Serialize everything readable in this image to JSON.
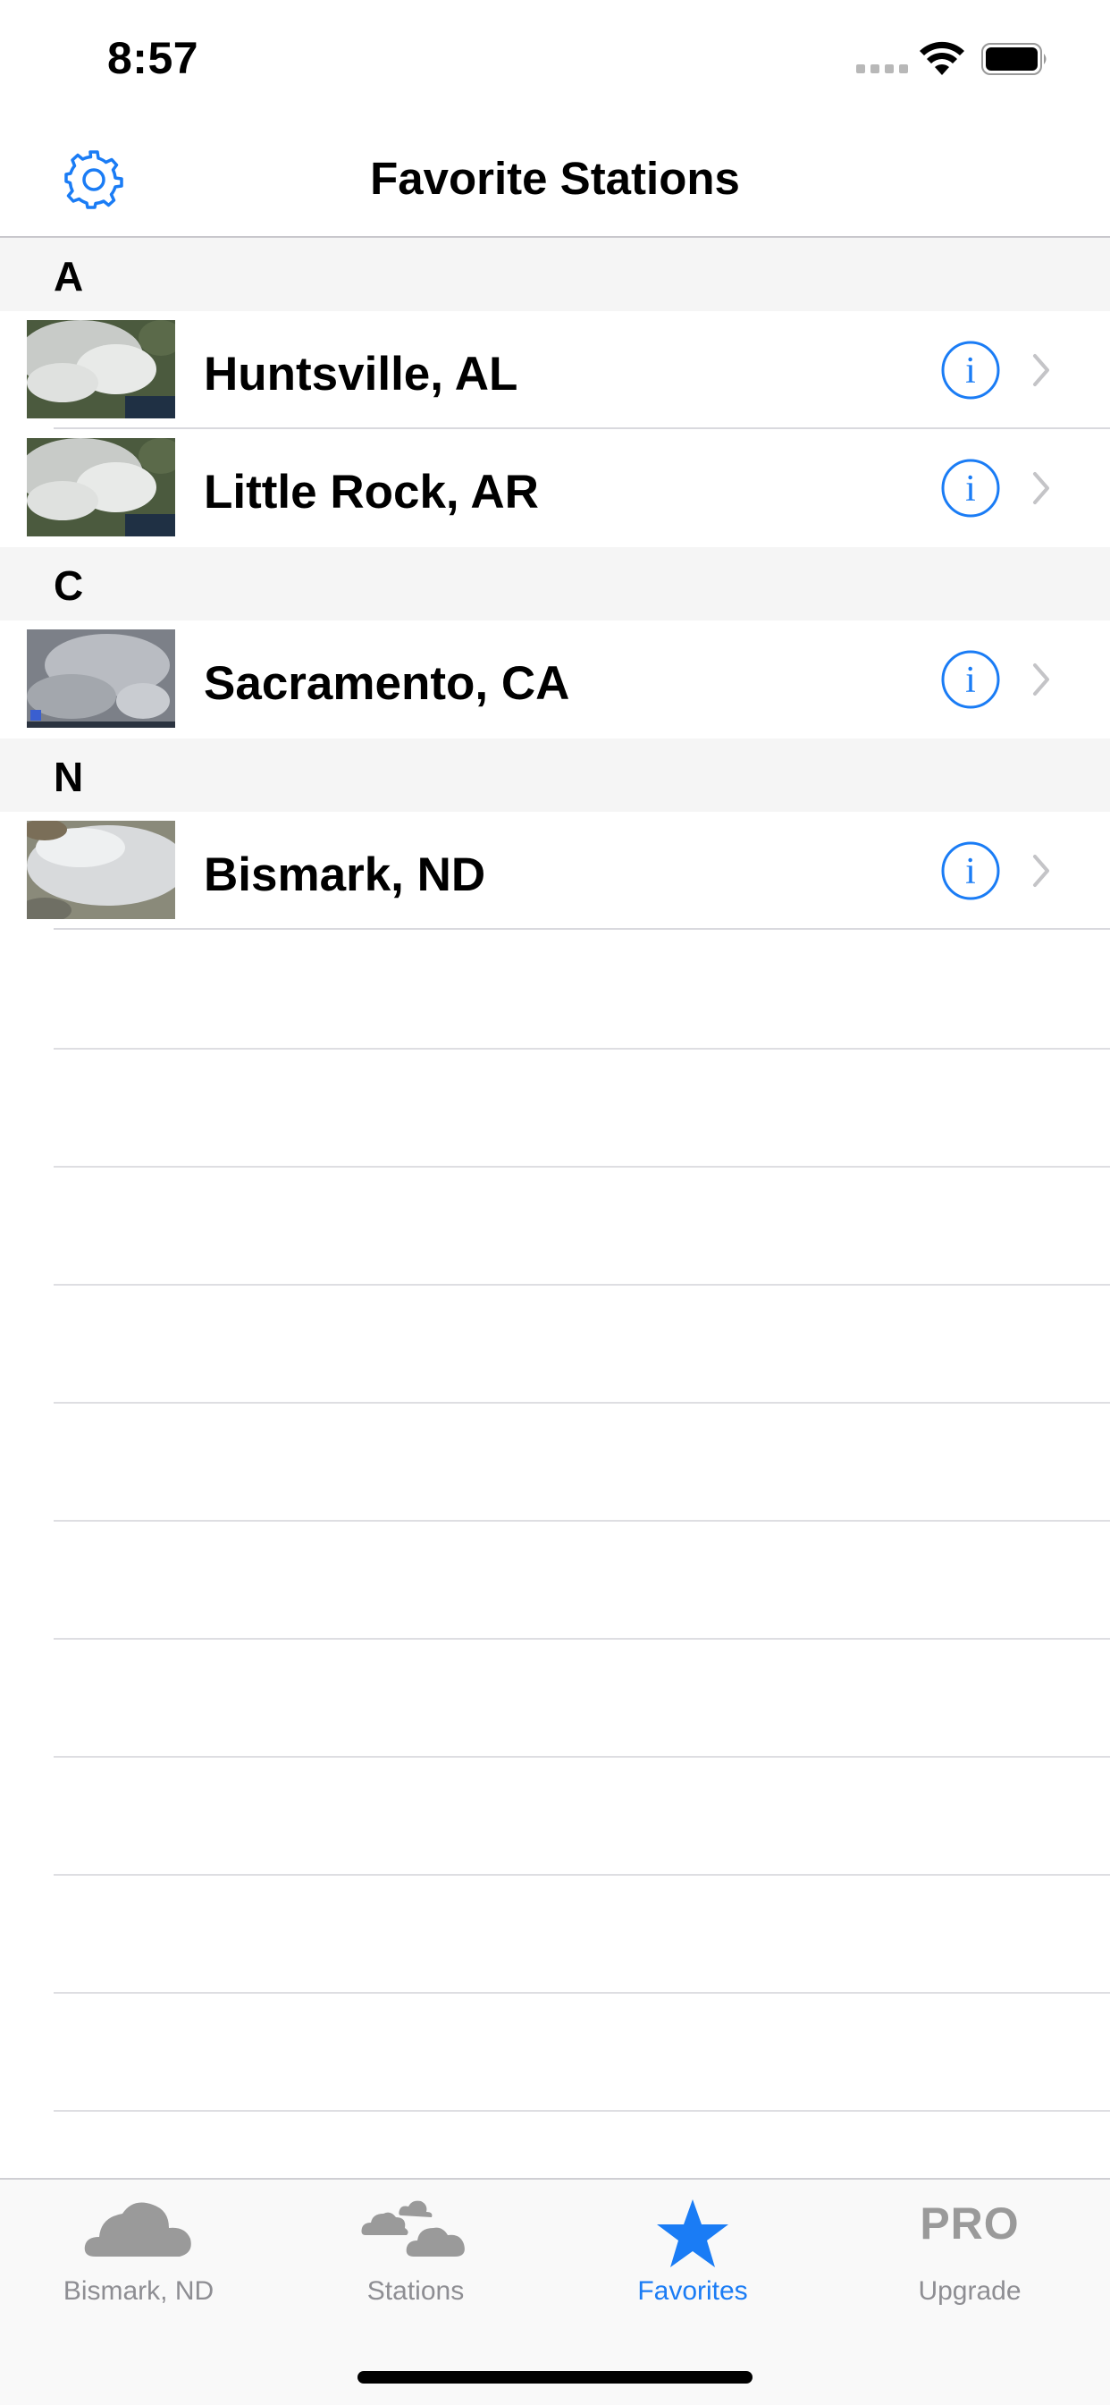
{
  "status_bar": {
    "time": "8:57"
  },
  "nav": {
    "title": "Favorite Stations",
    "settings_icon": "gear-icon"
  },
  "sections": [
    {
      "letter": "A",
      "stations": [
        "Huntsville, AL",
        "Little Rock, AR"
      ]
    },
    {
      "letter": "C",
      "stations": [
        "Sacramento, CA"
      ]
    },
    {
      "letter": "N",
      "stations": [
        "Bismark, ND"
      ]
    }
  ],
  "tabs": [
    {
      "label": "Bismark, ND",
      "icon": "cloud-icon",
      "active": false
    },
    {
      "label": "Stations",
      "icon": "clouds-icon",
      "active": false
    },
    {
      "label": "Favorites",
      "icon": "star-icon",
      "active": true
    },
    {
      "label": "Upgrade",
      "icon": "pro-icon",
      "icon_text": "PRO",
      "active": false
    }
  ],
  "colors": {
    "accent": "#1a7cf5",
    "inactive": "#8e8e93",
    "section_bg": "#f5f5f5"
  }
}
